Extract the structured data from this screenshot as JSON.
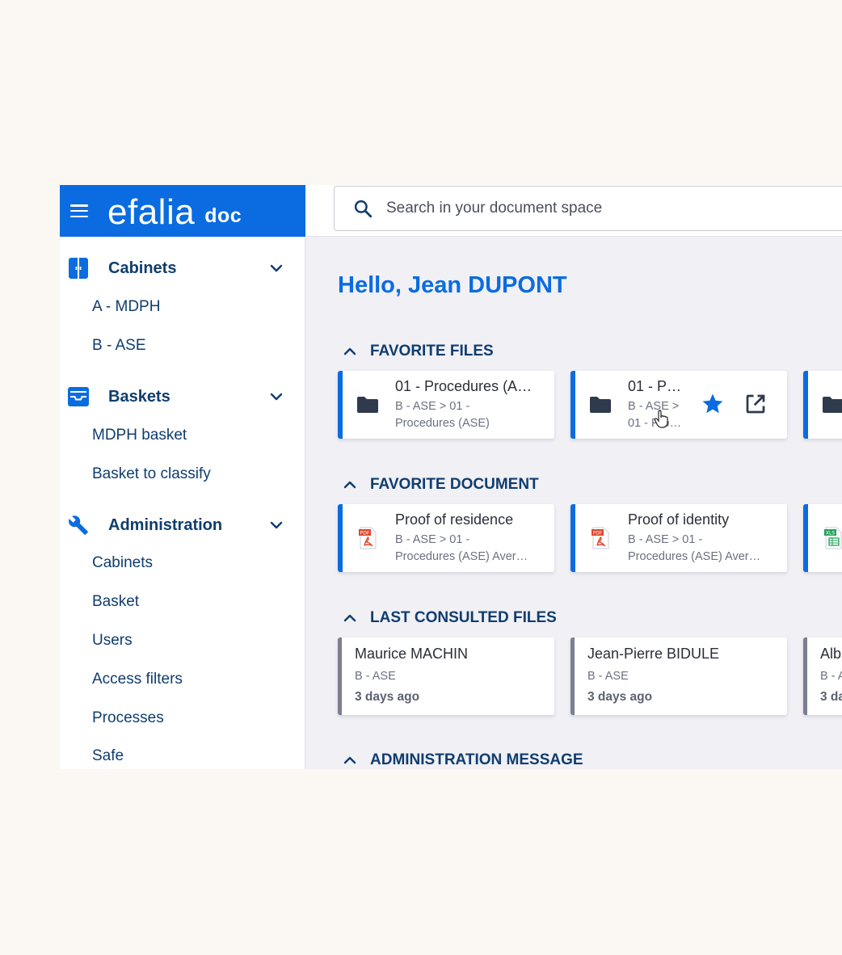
{
  "brand": {
    "name": "efalia",
    "product": "doc"
  },
  "search": {
    "placeholder": "Search in your document space"
  },
  "sidebar": {
    "cabinets": {
      "label": "Cabinets",
      "items": [
        "A - MDPH",
        "B - ASE"
      ]
    },
    "baskets": {
      "label": "Baskets",
      "items": [
        "MDPH basket",
        "Basket to classify"
      ]
    },
    "administration": {
      "label": "Administration",
      "items": [
        "Cabinets",
        "Basket",
        "Users",
        "Access filters",
        "Processes",
        "Safe"
      ]
    }
  },
  "main": {
    "greeting": "Hello, Jean DUPONT",
    "favorite_files": {
      "heading": "FAVORITE FILES",
      "cards": [
        {
          "title": "01 - Procedures (A…",
          "path1": "B - ASE > 01 -",
          "path2": "Procedures (ASE)"
        },
        {
          "title": "01 - Pr…",
          "path1": "B - ASE >",
          "path2": "01 - Pro…"
        },
        {
          "title": "",
          "path1": "",
          "path2": ""
        }
      ]
    },
    "favorite_document": {
      "heading": "FAVORITE DOCUMENT",
      "cards": [
        {
          "title": "Proof of residence",
          "path1": "B - ASE > 01 -",
          "path2": "Procedures (ASE) Aver…",
          "icon": "pdf-icon"
        },
        {
          "title": "Proof of identity",
          "path1": "B - ASE > 01 -",
          "path2": "Procedures (ASE) Aver…",
          "icon": "pdf-icon"
        },
        {
          "title": "",
          "path1": "",
          "path2": "",
          "icon": "xls-icon"
        }
      ]
    },
    "last_consulted": {
      "heading": "LAST CONSULTED FILES",
      "cards": [
        {
          "title": "Maurice MACHIN",
          "cabinet": "B - ASE",
          "when": "3 days ago"
        },
        {
          "title": "Jean-Pierre BIDULE",
          "cabinet": "B - ASE",
          "when": "3 days ago"
        },
        {
          "title": "Alb",
          "cabinet": "B - A",
          "when": "3 da"
        }
      ]
    },
    "admin_message": {
      "heading": "ADMINISTRATION MESSAGE"
    }
  },
  "colors": {
    "brand_blue": "#0a6ce0",
    "navy": "#0f3d6e",
    "page_bg": "#fbf7f2",
    "content_bg": "#f1f0f5"
  }
}
